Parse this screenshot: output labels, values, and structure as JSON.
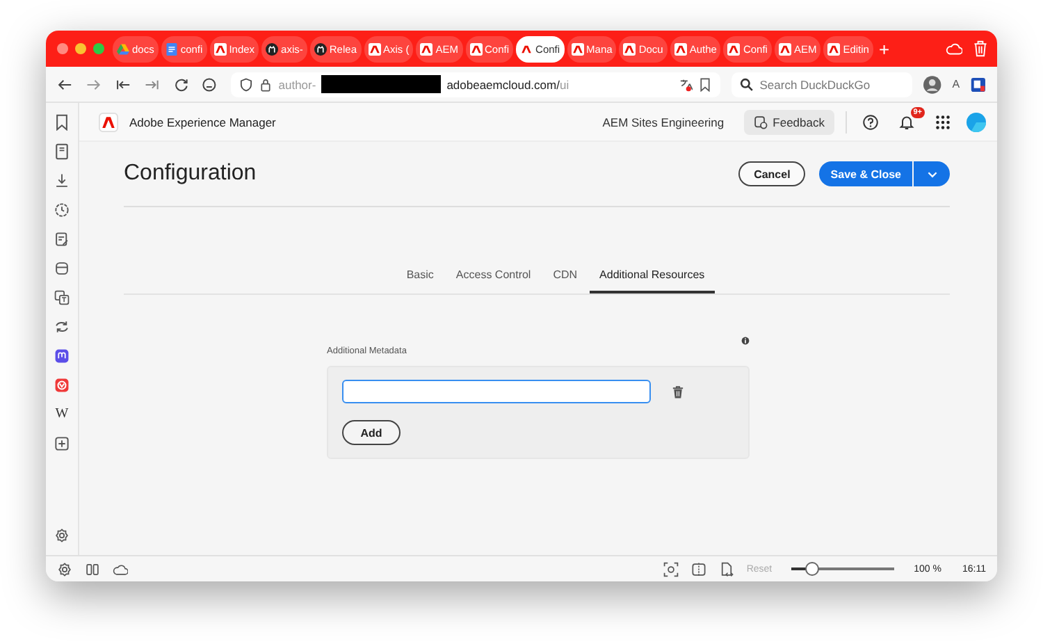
{
  "browser": {
    "tabs": [
      {
        "label": "docs",
        "kind": "drive",
        "selected": false
      },
      {
        "label": "confi",
        "kind": "doc",
        "selected": false
      },
      {
        "label": "Index",
        "kind": "adobe",
        "selected": false
      },
      {
        "label": "axis-",
        "kind": "github",
        "selected": false
      },
      {
        "label": "Relea",
        "kind": "github",
        "selected": false
      },
      {
        "label": "Axis (",
        "kind": "adobe",
        "selected": false
      },
      {
        "label": "AEM",
        "kind": "adobe",
        "selected": false
      },
      {
        "label": "Confi",
        "kind": "adobe",
        "selected": false
      },
      {
        "label": "Confi",
        "kind": "adobe",
        "selected": true
      },
      {
        "label": "Mana",
        "kind": "adobe",
        "selected": false
      },
      {
        "label": "Docu",
        "kind": "adobe",
        "selected": false
      },
      {
        "label": "Authe",
        "kind": "adobe",
        "selected": false
      },
      {
        "label": "Confi",
        "kind": "adobe",
        "selected": false
      },
      {
        "label": "AEM",
        "kind": "adobe",
        "selected": false
      },
      {
        "label": "Editin",
        "kind": "adobe",
        "selected": false
      }
    ],
    "new_tab": "+",
    "url_prefix": "author-",
    "url_suffix": "adobeaemcloud.com/",
    "url_path": "ui",
    "search": {
      "placeholder": "Search DuckDuckGo"
    },
    "profile_letter": "A",
    "sidebar_letter": "W"
  },
  "app": {
    "product": "Adobe Experience Manager",
    "org": "AEM Sites Engineering",
    "feedback": "Feedback",
    "badge": "9+"
  },
  "page": {
    "title": "Configuration",
    "cancel": "Cancel",
    "save": "Save & Close",
    "tabs": [
      {
        "label": "Basic",
        "selected": false
      },
      {
        "label": "Access Control",
        "selected": false
      },
      {
        "label": "CDN",
        "selected": false
      },
      {
        "label": "Additional Resources",
        "selected": true
      }
    ],
    "section_label": "Additional Metadata",
    "add": "Add"
  },
  "status_bar": {
    "reset": "Reset",
    "reset_disabled": true,
    "zoom": {
      "level": 0.18
    },
    "zoom_text": "100 %",
    "time": "16:11"
  }
}
